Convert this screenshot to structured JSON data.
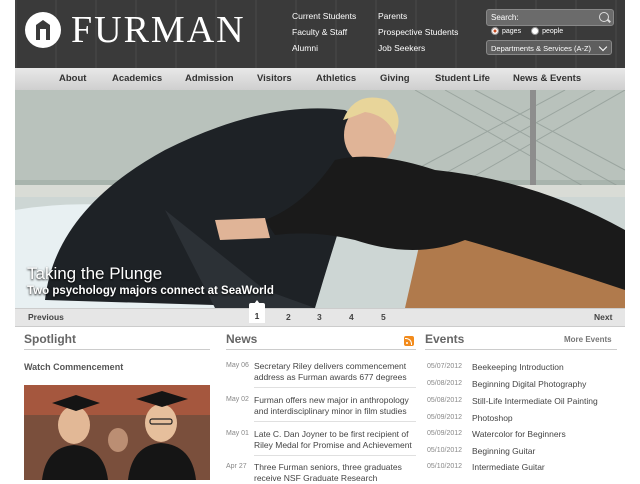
{
  "header": {
    "wordmark": "FURMAN",
    "quick_links": [
      {
        "label": "Current Students"
      },
      {
        "label": "Parents"
      },
      {
        "label": "Faculty & Staff"
      },
      {
        "label": "Prospective Students"
      },
      {
        "label": "Alumni"
      },
      {
        "label": "Job Seekers"
      }
    ],
    "search": {
      "placeholder": "Search:"
    },
    "search_scope": [
      {
        "label": "pages",
        "selected": true
      },
      {
        "label": "people",
        "selected": false
      }
    ],
    "departments_select": "Departments & Services (A-Z)"
  },
  "nav": {
    "items": [
      {
        "label": "About"
      },
      {
        "label": "Academics"
      },
      {
        "label": "Admission"
      },
      {
        "label": "Visitors"
      },
      {
        "label": "Athletics"
      },
      {
        "label": "Giving"
      },
      {
        "label": "Student Life"
      },
      {
        "label": "News & Events"
      }
    ]
  },
  "hero": {
    "title": "Taking the Plunge",
    "subtitle": "Two psychology majors connect at SeaWorld"
  },
  "pager": {
    "previous": "Previous",
    "next": "Next",
    "pages": [
      "1",
      "2",
      "3",
      "4",
      "5"
    ],
    "active_page": "1"
  },
  "spotlight": {
    "heading": "Spotlight",
    "link": "Watch Commencement"
  },
  "news": {
    "heading": "News",
    "items": [
      {
        "date": "May 06",
        "text": "Secretary Riley delivers commencement address as Furman awards 677 degrees"
      },
      {
        "date": "May 02",
        "text": "Furman offers new major in anthropology and interdisciplinary minor in film studies"
      },
      {
        "date": "May 01",
        "text": "Late C. Dan Joyner to be first recipient of Riley Medal for Promise and Achievement"
      },
      {
        "date": "Apr 27",
        "text": "Three Furman seniors, three graduates receive NSF Graduate Research"
      }
    ]
  },
  "events": {
    "heading": "Events",
    "more_label": "More Events",
    "items": [
      {
        "date": "05/07/2012",
        "title": "Beekeeping Introduction"
      },
      {
        "date": "05/08/2012",
        "title": "Beginning Digital Photography"
      },
      {
        "date": "05/08/2012",
        "title": "Still-Life Intermediate Oil Painting"
      },
      {
        "date": "05/09/2012",
        "title": "Photoshop"
      },
      {
        "date": "05/09/2012",
        "title": "Watercolor for Beginners"
      },
      {
        "date": "05/10/2012",
        "title": "Beginning Guitar"
      },
      {
        "date": "05/10/2012",
        "title": "Intermediate Guitar"
      }
    ]
  },
  "colors": {
    "header_bg": "#3a3a3a",
    "nav_bg": "#d8d8d8",
    "rss_orange": "#f28b1c"
  }
}
